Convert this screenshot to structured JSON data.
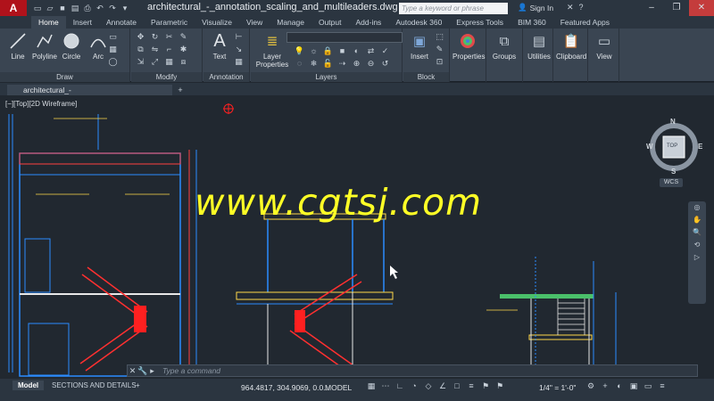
{
  "title_bar": {
    "app_letter": "A",
    "document_title": "architectural_-_annotation_scaling_and_multileaders.dwg",
    "search_placeholder": "Type a keyword or phrase",
    "sign_in": "Sign In"
  },
  "ribbon_tabs": [
    "Home",
    "Insert",
    "Annotate",
    "Parametric",
    "Visualize",
    "View",
    "Manage",
    "Output",
    "Add-ins",
    "Autodesk 360",
    "Express Tools",
    "BIM 360",
    "Featured Apps"
  ],
  "ribbon": {
    "draw": {
      "label": "Draw",
      "tools": [
        "Line",
        "Polyline",
        "Circle",
        "Arc"
      ]
    },
    "modify": {
      "label": "Modify"
    },
    "annotation": {
      "label": "Annotation",
      "text_tool": "Text"
    },
    "layers": {
      "label": "Layers",
      "layer_properties": "Layer\nProperties"
    },
    "block": {
      "label": "Block",
      "insert": "Insert"
    },
    "properties": {
      "label": "Properties"
    },
    "groups": {
      "label": "Groups"
    },
    "utilities": {
      "label": "Utilities"
    },
    "clipboard": {
      "label": "Clipboard"
    },
    "view": {
      "label": "View"
    }
  },
  "file_tab": {
    "name": "architectural_-_anno...ling_and_multileaders",
    "plus": "+"
  },
  "viewport": {
    "label": "[−][Top][2D Wireframe]",
    "viewcube": {
      "n": "N",
      "s": "S",
      "e": "E",
      "w": "W",
      "top": "TOP"
    },
    "wcs": "WCS"
  },
  "watermark": "www.cgtsj.com",
  "command_line": {
    "placeholder": "Type a command"
  },
  "status": {
    "layout_tabs": [
      "Model",
      "SECTIONS AND DETAILS"
    ],
    "add_tab": "+",
    "coordinates": "964.4817, 304.9069, 0.0...",
    "model_button": "MODEL",
    "annotation_scale": "1/4\" = 1'-0\""
  },
  "colors": {
    "canvas": "#212830",
    "ribbon": "#3a4552",
    "drawing_blue": "#2b8cff",
    "drawing_red": "#ff2a2a",
    "drawing_white": "#e8e8e8",
    "drawing_yellow": "#ffd94a",
    "watermark": "#ffff26"
  }
}
